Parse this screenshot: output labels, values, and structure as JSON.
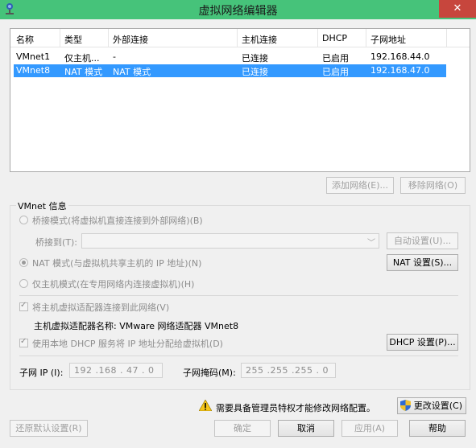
{
  "window": {
    "title": "虚拟网络编辑器",
    "close_symbol": "✕"
  },
  "table": {
    "columns": [
      "名称",
      "类型",
      "外部连接",
      "主机连接",
      "DHCP",
      "子网地址"
    ],
    "rows": [
      {
        "name": "VMnet1",
        "type": "仅主机...",
        "external": "-",
        "host": "已连接",
        "dhcp": "已启用",
        "subnet": "192.168.44.0",
        "selected": false
      },
      {
        "name": "VMnet8",
        "type": "NAT 模式",
        "external": "NAT 模式",
        "host": "已连接",
        "dhcp": "已启用",
        "subnet": "192.168.47.0",
        "selected": true
      }
    ]
  },
  "list_buttons": {
    "add": "添加网络(E)...",
    "remove": "移除网络(O)"
  },
  "vmnet_info": {
    "group_label": "VMnet 信息",
    "bridge_mode": "桥接模式(将虚拟机直接连接到外部网络)(B)",
    "bridge_to_label": "桥接到(T):",
    "bridge_to_value": "",
    "auto_settings": "自动设置(U)...",
    "nat_mode": "NAT 模式(与虚拟机共享主机的 IP 地址)(N)",
    "nat_settings": "NAT 设置(S)...",
    "host_only": "仅主机模式(在专用网络内连接虚拟机)(H)",
    "connect_adapter": "将主机虚拟适配器连接到此网络(V)",
    "adapter_name": "主机虚拟适配器名称: VMware 网络适配器 VMnet8",
    "use_dhcp": "使用本地 DHCP 服务将 IP 地址分配给虚拟机(D)",
    "dhcp_settings": "DHCP 设置(P)...",
    "subnet_ip_label": "子网 IP (I):",
    "subnet_ip": "192 .168 . 47 . 0",
    "subnet_mask_label": "子网掩码(M):",
    "subnet_mask": "255 .255 .255 . 0"
  },
  "admin_notice": "需要具备管理员特权才能修改网络配置。",
  "change_settings": "更改设置(C)",
  "footer": {
    "restore_defaults": "还原默认设置(R)",
    "ok": "确定",
    "cancel": "取消",
    "apply": "应用(A)",
    "help": "帮助"
  },
  "colors": {
    "titlebar": "#46c37a",
    "selection": "#3399ff",
    "close": "#c7463d"
  }
}
